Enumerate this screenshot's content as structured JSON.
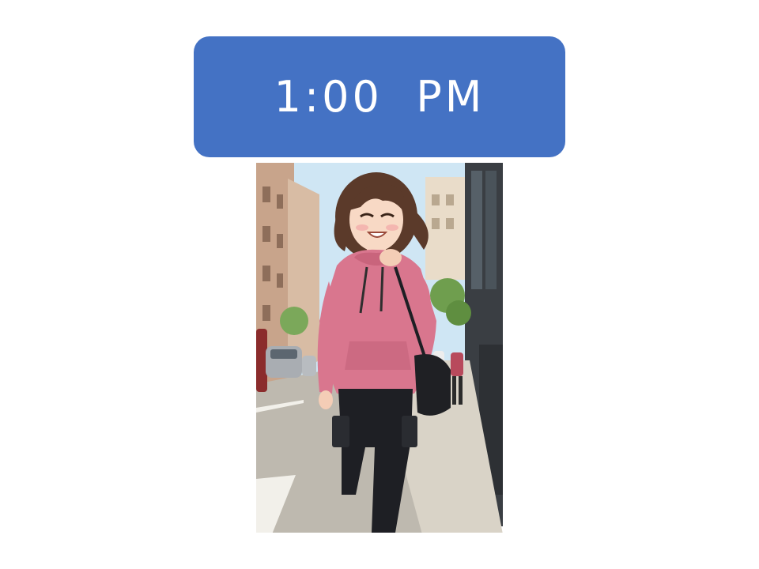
{
  "banner": {
    "time_text": "1:00  PM",
    "background_color": "#4472C4",
    "text_color": "#FFFFFF"
  },
  "illustration": {
    "subject": "smiling-girl-pink-hoodie-city-street-icon"
  },
  "colors": {
    "sky": "#C9E3F2",
    "hoodie": "#D9768E",
    "pants": "#1E1F24",
    "hair": "#5B3A2A",
    "building_left": "#C9A98F",
    "building_right": "#3B3F44",
    "sidewalk": "#D8D2C6",
    "road": "#BDB8AE"
  }
}
